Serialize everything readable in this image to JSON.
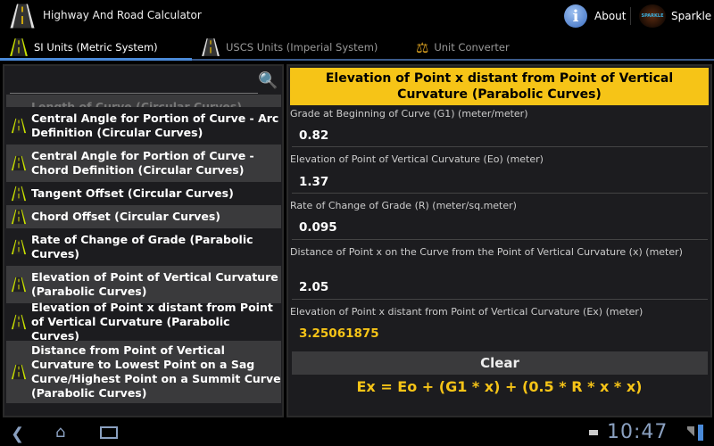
{
  "app": {
    "title": "Highway And Road Calculator",
    "about": "About",
    "sparkle": "Sparkle"
  },
  "tabs": [
    {
      "label": "SI Units (Metric System)"
    },
    {
      "label": "USCS Units (Imperial System)"
    },
    {
      "label": "Unit Converter"
    }
  ],
  "list": {
    "partial_top": "Length of Curve (Circular Curves)",
    "items": [
      "Central Angle for Portion of Curve - Arc Definition (Circular Curves)",
      "Central Angle for Portion of Curve - Chord Definition (Circular Curves)",
      "Tangent Offset (Circular Curves)",
      "Chord Offset (Circular Curves)",
      "Rate of Change of Grade (Parabolic Curves)",
      "Elevation of Point of Vertical Curvature (Parabolic Curves)",
      "Elevation of Point x distant from Point of Vertical Curvature (Parabolic Curves)",
      "Distance from Point of Vertical Curvature to Lowest Point on a Sag Curve/Highest Point on a Summit Curve (Parabolic Curves)"
    ]
  },
  "form": {
    "title": "Elevation of Point x distant from Point of Vertical Curvature (Parabolic Curves)",
    "fields": [
      {
        "label": "Grade at Beginning of Curve (G1) (meter/meter)",
        "value": "0.82"
      },
      {
        "label": "Elevation of Point of Vertical Curvature (Eo) (meter)",
        "value": "1.37"
      },
      {
        "label": "Rate of Change of Grade (R) (meter/sq.meter)",
        "value": "0.095"
      },
      {
        "label": "Distance of Point x on the Curve from the Point of Vertical Curvature (x) (meter)",
        "value": "2.05"
      }
    ],
    "result_label": "Elevation of Point x distant from Point of Vertical Curvature (Ex) (meter)",
    "result": "3.25061875",
    "clear": "Clear",
    "formula": "Ex = Eo + (G1 * x) + (0.5 * R * x * x)"
  },
  "status": {
    "time": "10:47"
  },
  "colors": {
    "accent": "#f6c417",
    "tab": "#4a8ad8"
  }
}
